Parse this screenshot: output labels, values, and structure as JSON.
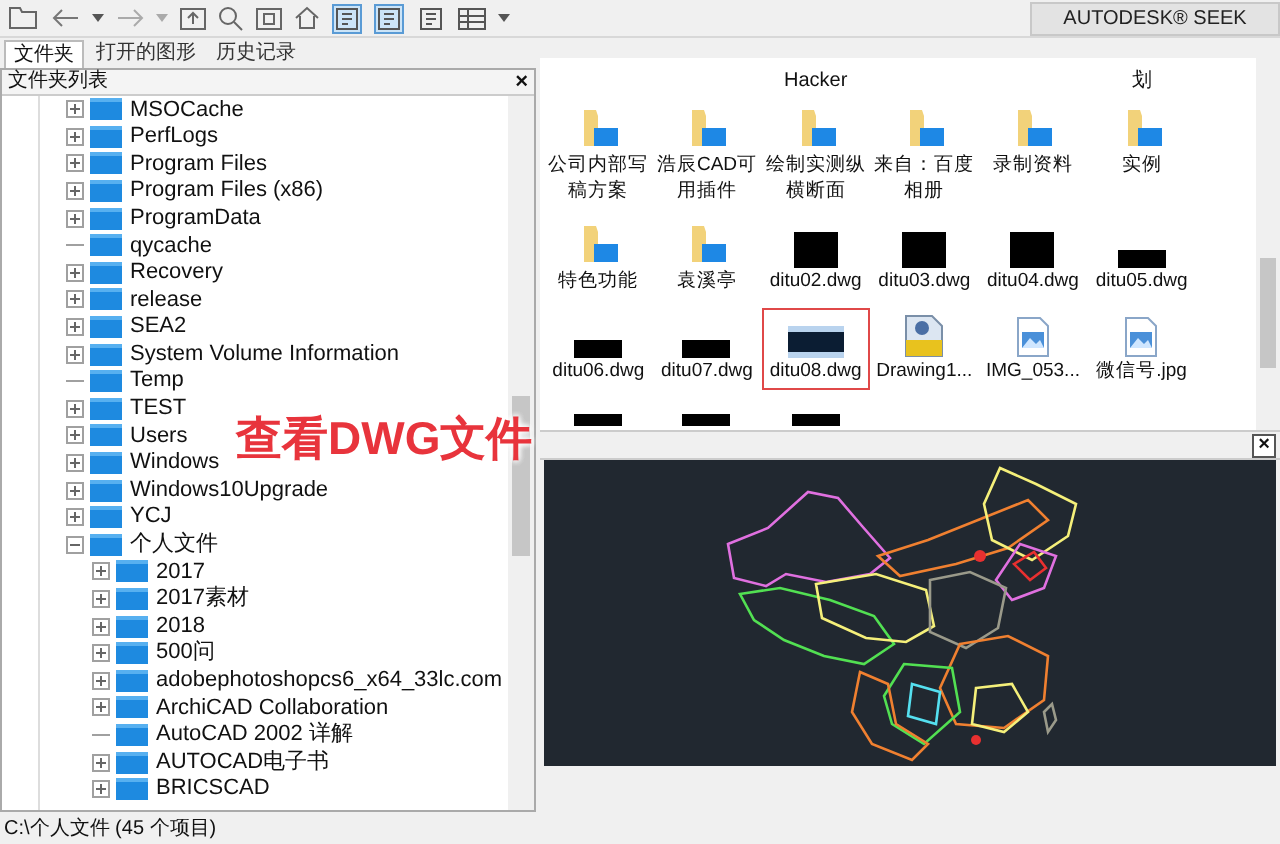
{
  "toolbar": {
    "toggles": [
      {
        "pressed": true
      },
      {
        "pressed": true
      },
      {
        "pressed": false
      }
    ]
  },
  "tabs": [
    {
      "label": "文件夹",
      "selected": true
    },
    {
      "label": "打开的图形",
      "selected": false
    },
    {
      "label": "历史记录",
      "selected": false
    }
  ],
  "folder_panel": {
    "title": "文件夹列表",
    "close": "×",
    "tree": [
      {
        "label": "MSOCache",
        "expandable": true,
        "expanded": false
      },
      {
        "label": "PerfLogs",
        "expandable": true,
        "expanded": false
      },
      {
        "label": "Program Files",
        "expandable": true,
        "expanded": false
      },
      {
        "label": "Program Files (x86)",
        "expandable": true,
        "expanded": false
      },
      {
        "label": "ProgramData",
        "expandable": true,
        "expanded": false
      },
      {
        "label": "qycache",
        "expandable": false
      },
      {
        "label": "Recovery",
        "expandable": true,
        "expanded": false
      },
      {
        "label": "release",
        "expandable": true,
        "expanded": false
      },
      {
        "label": "SEA2",
        "expandable": true,
        "expanded": false
      },
      {
        "label": "System Volume Information",
        "expandable": true,
        "expanded": false
      },
      {
        "label": "Temp",
        "expandable": false
      },
      {
        "label": "TEST",
        "expandable": true,
        "expanded": false
      },
      {
        "label": "Users",
        "expandable": true,
        "expanded": false
      },
      {
        "label": "Windows",
        "expandable": true,
        "expanded": false
      },
      {
        "label": "Windows10Upgrade",
        "expandable": true,
        "expanded": false
      },
      {
        "label": "YCJ",
        "expandable": true,
        "expanded": false
      },
      {
        "label": "个人文件",
        "expandable": true,
        "expanded": true,
        "children": [
          {
            "label": "2017",
            "expandable": true,
            "expanded": false
          },
          {
            "label": "2017素材",
            "expandable": true,
            "expanded": false
          },
          {
            "label": "2018",
            "expandable": true,
            "expanded": false
          },
          {
            "label": "500问",
            "expandable": true,
            "expanded": false
          },
          {
            "label": "adobephotoshopcs6_x64_33lc.com",
            "expandable": true,
            "expanded": false
          },
          {
            "label": "ArchiCAD Collaboration",
            "expandable": true,
            "expanded": false
          },
          {
            "label": "AutoCAD 2002 详解",
            "expandable": false
          },
          {
            "label": "AUTOCAD电子书",
            "expandable": true,
            "expanded": false
          },
          {
            "label": "BRICSCAD",
            "expandable": true,
            "expanded": false
          }
        ]
      }
    ]
  },
  "status_bar": "C:\\个人文件 (45 个项目)",
  "seek_button": "AUTODESK® SEEK",
  "files": {
    "cut_row": [
      {
        "kind": "blank"
      },
      {
        "kind": "blank"
      },
      {
        "kind": "text",
        "label": "Hacker"
      },
      {
        "kind": "blank"
      },
      {
        "kind": "blank"
      },
      {
        "kind": "text",
        "label": "划"
      }
    ],
    "items": [
      {
        "kind": "folder",
        "label": "公司内部写稿方案",
        "selected": false
      },
      {
        "kind": "folder",
        "label": "浩辰CAD可用插件",
        "selected": false
      },
      {
        "kind": "folder",
        "label": "绘制实测纵横断面",
        "selected": false
      },
      {
        "kind": "folder",
        "label": "来自：百度相册",
        "selected": false
      },
      {
        "kind": "folder",
        "label": "录制资料",
        "selected": false
      },
      {
        "kind": "folder",
        "label": "实例",
        "selected": false
      },
      {
        "kind": "folder",
        "label": "特色功能",
        "selected": false
      },
      {
        "kind": "folder",
        "label": "袁溪亭",
        "selected": false
      },
      {
        "kind": "dwg-square",
        "label": "ditu02.dwg",
        "selected": false
      },
      {
        "kind": "dwg-square",
        "label": "ditu03.dwg",
        "selected": false
      },
      {
        "kind": "dwg-square",
        "label": "ditu04.dwg",
        "selected": false
      },
      {
        "kind": "dwg-wide",
        "label": "ditu05.dwg",
        "selected": false
      },
      {
        "kind": "dwg-wide",
        "label": "ditu06.dwg",
        "selected": false
      },
      {
        "kind": "dwg-wide",
        "label": "ditu07.dwg",
        "selected": false
      },
      {
        "kind": "dwg-wide",
        "label": "ditu08.dwg",
        "selected": true
      },
      {
        "kind": "drawing",
        "label": "Drawing1...",
        "selected": false
      },
      {
        "kind": "image",
        "label": "IMG_053...",
        "selected": false
      },
      {
        "kind": "image",
        "label": "微信号.jpg",
        "selected": false
      }
    ]
  },
  "preview": {
    "close": "×"
  },
  "callout": "查看DWG文件"
}
